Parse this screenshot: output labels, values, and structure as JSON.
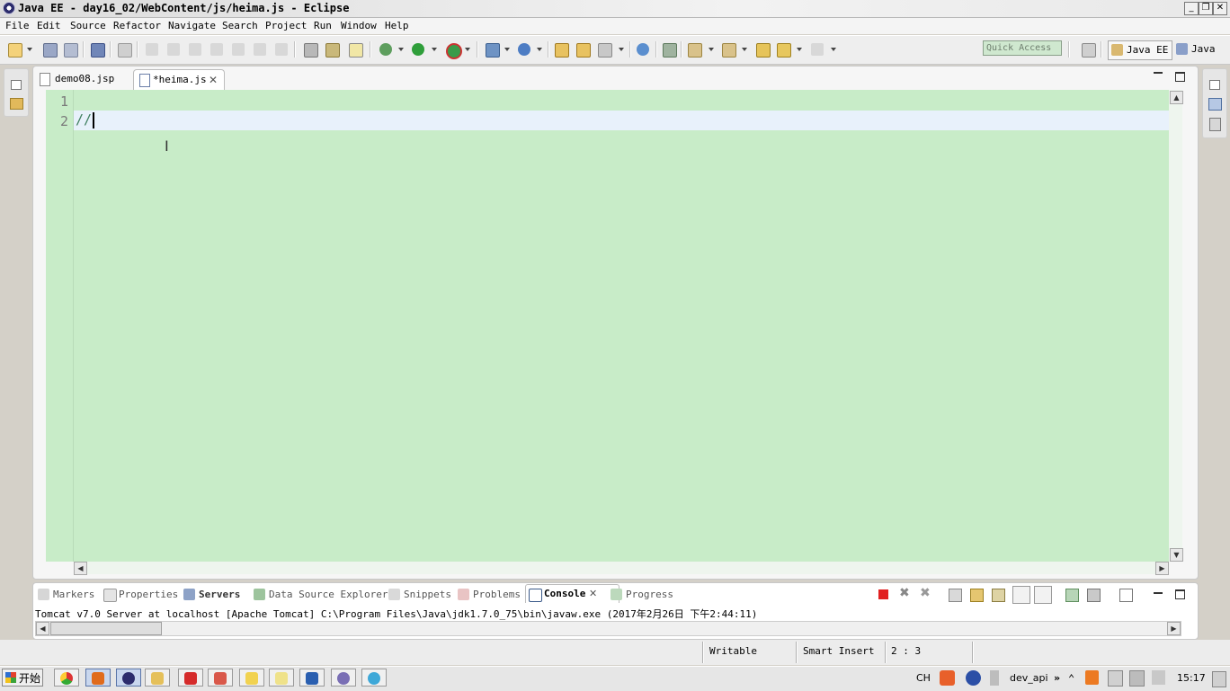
{
  "window": {
    "title": "Java EE - day16_02/WebContent/js/heima.js - Eclipse",
    "controls": {
      "minimize": "_",
      "restore": "❐",
      "close": "✕"
    }
  },
  "menu": [
    "File",
    "Edit",
    "Source",
    "Refactor",
    "Navigate",
    "Search",
    "Project",
    "Run",
    "Window",
    "Help"
  ],
  "toolbar": {
    "quick_access_placeholder": "Quick Access",
    "perspectives": [
      "Java EE",
      "Java"
    ]
  },
  "editor": {
    "tabs": [
      {
        "label": "demo08.jsp",
        "active": false
      },
      {
        "label": "*heima.js",
        "active": true,
        "close": "✕"
      }
    ],
    "line_numbers": [
      "1",
      "2"
    ],
    "code_lines": [
      "",
      "//"
    ],
    "background_color": "#c8ecc8",
    "current_line_color": "#e8f1fb"
  },
  "bottom_panel": {
    "tabs": [
      "Markers",
      "Properties",
      "Servers",
      "Data Source Explorer",
      "Snippets",
      "Problems",
      "Console",
      "Progress"
    ],
    "active_tab": "Console",
    "console_text": "Tomcat v7.0 Server at localhost [Apache Tomcat] C:\\Program Files\\Java\\jdk1.7.0_75\\bin\\javaw.exe (2017年2月26日 下午2:44:11)"
  },
  "status": {
    "writable": "Writable",
    "insert_mode": "Smart Insert",
    "position": "2 : 3"
  },
  "taskbar": {
    "start_label": "开始",
    "tray": {
      "lang": "CH",
      "user": "dev_api",
      "clock": "15:17"
    }
  }
}
